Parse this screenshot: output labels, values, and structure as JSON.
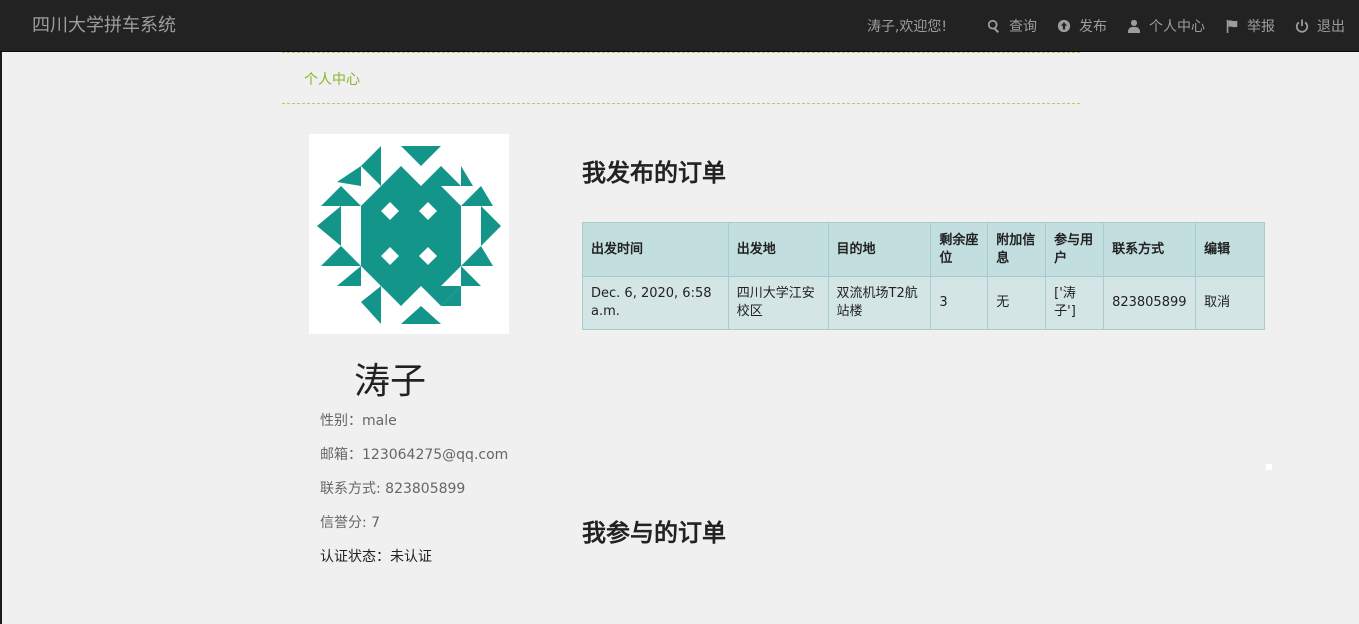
{
  "navbar": {
    "brand": "四川大学拼车系统",
    "welcome": "涛子,欢迎您!",
    "items": [
      {
        "label": "查询",
        "icon": "search-icon"
      },
      {
        "label": "发布",
        "icon": "upload-circle-icon"
      },
      {
        "label": "个人中心",
        "icon": "user-icon"
      },
      {
        "label": "举报",
        "icon": "flag-icon"
      },
      {
        "label": "退出",
        "icon": "power-icon"
      }
    ]
  },
  "breadcrumb": "个人中心",
  "profile": {
    "avatar_color": "#14958a",
    "name": "涛子",
    "gender": "性别：male",
    "email": "邮箱：123064275@qq.com",
    "contact": "联系方式: 823805899",
    "credit": "信誉分: 7",
    "verification": "认证状态：未认证"
  },
  "published": {
    "title": "我发布的订单",
    "columns": [
      "出发时间",
      "出发地",
      "目的地",
      "剩余座位",
      "附加信息",
      "参与用户",
      "联系方式",
      "编辑"
    ],
    "rows": [
      {
        "departure_time": "Dec. 6, 2020, 6:58 a.m.",
        "origin": "四川大学江安校区",
        "destination": "双流机场T2航站楼",
        "seats": "3",
        "extra": "无",
        "participants": "['涛子']",
        "contact": "823805899",
        "action": "取消"
      }
    ]
  },
  "joined": {
    "title": "我参与的订单"
  },
  "colors": {
    "navbar_bg": "#222222",
    "accent_green": "#8ab32a",
    "table_header": "#c2dedf",
    "table_row": "#d3e5e5"
  }
}
